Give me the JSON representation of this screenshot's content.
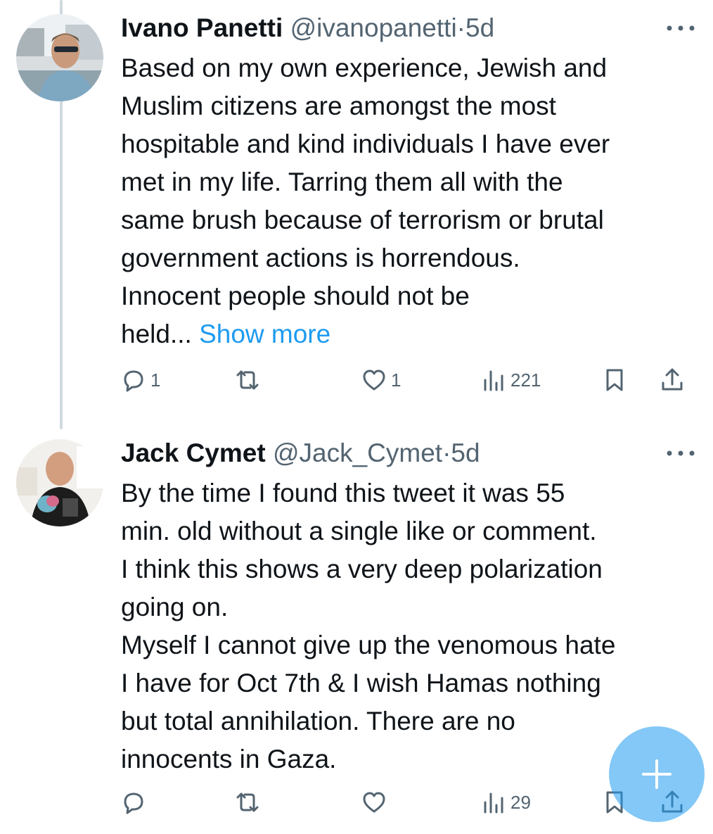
{
  "tweets": [
    {
      "name": "Ivano Panetti",
      "handle": "@ivanopanetti",
      "separator": "·",
      "time": "5d",
      "text": "Based on my own experience, Jewish and\nMuslim citizens are amongst the most\nhospitable and kind individuals I have ever\nmet in my life. Tarring them all with the\nsame brush because of terrorism or brutal\ngovernment actions is horrendous.\nInnocent people should not be\nheld...",
      "show_more": "Show more",
      "replies": "1",
      "retweets": "",
      "likes": "1",
      "views": "221",
      "avatar_icon": "profile-photo-man-sunglasses"
    },
    {
      "name": "Jack Cymet",
      "handle": "@Jack_Cymet",
      "separator": "·",
      "time": "5d",
      "text": "By the time I found this tweet it was 55\nmin. old without a single like or comment.\nI think this shows a very deep polarization\ngoing on.\nMyself I cannot give up the venomous hate\nI have for Oct 7th & I wish Hamas nothing\nbut total annihilation. There are no\ninnocents in Gaza.",
      "replies": "",
      "retweets": "",
      "likes": "",
      "views": "29",
      "avatar_icon": "profile-photo-bald-man"
    }
  ],
  "fab": {
    "icon": "plus-icon"
  },
  "colors": {
    "text": "#0f1419",
    "secondary": "#536471",
    "link": "#1d9bf0",
    "thread_line": "#cfd9de"
  }
}
